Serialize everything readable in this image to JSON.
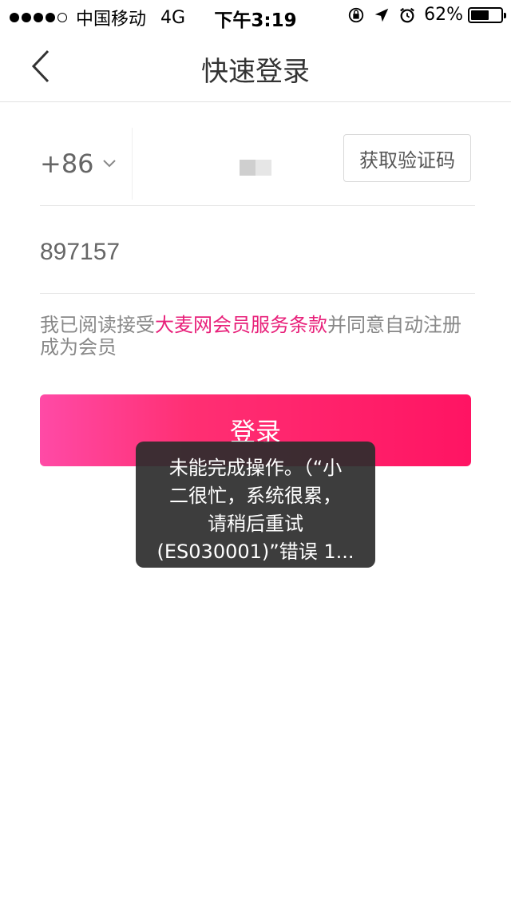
{
  "status_bar": {
    "carrier": "中国移动",
    "network": "4G",
    "time": "下午3:19",
    "battery_percent": "62%",
    "battery_level": 0.62,
    "icons": [
      "orientation-lock-icon",
      "location-arrow-icon",
      "alarm-icon",
      "battery-icon"
    ]
  },
  "nav": {
    "title": "快速登录",
    "back_icon": "chevron-left-icon"
  },
  "form": {
    "country_code": "+86",
    "phone_value": "",
    "sms_button_label": "获取验证码",
    "code_value": "897157"
  },
  "terms": {
    "prefix": "我已阅读接受",
    "link": "大麦网会员服务条款",
    "suffix": "并同意自动注册成为会员"
  },
  "login_button_label": "登录",
  "toast": {
    "line1": "未能完成操作。（“小",
    "line2": "二很忙，系统很累，",
    "line3": "请稍后重试",
    "line4": "(ES030001)”错误 1..."
  },
  "colors": {
    "accent": "#e8207a",
    "button_gradient_start": "#ff4aa6",
    "button_gradient_end": "#ff1463"
  }
}
